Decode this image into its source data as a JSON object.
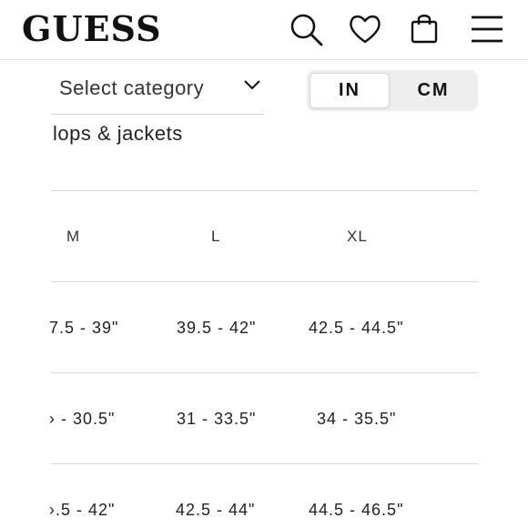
{
  "header": {
    "logo": "GUESS",
    "icons": [
      "search-icon",
      "heart-icon",
      "bag-icon",
      "menu-icon"
    ]
  },
  "category_select": {
    "label": "Select category",
    "icon": "chevron-down-icon"
  },
  "unit_toggle": {
    "active": "IN",
    "inactive": "CM"
  },
  "section_title": "lops & jackets",
  "size_table": {
    "columns": [
      "M",
      "L",
      "XL"
    ],
    "rows": [
      [
        "7.5 - 39\"",
        "39.5 - 42\"",
        "42.5 - 44.5\""
      ],
      [
        "› - 30.5\"",
        "31 - 33.5\"",
        "34 - 35.5\""
      ],
      [
        "›.5 - 42\"",
        "42.5 - 44\"",
        "44.5 - 46.5\""
      ]
    ]
  },
  "colors": {
    "text": "#111111",
    "divider": "#d9d9d9",
    "toggle_bg": "#eeeeee"
  }
}
